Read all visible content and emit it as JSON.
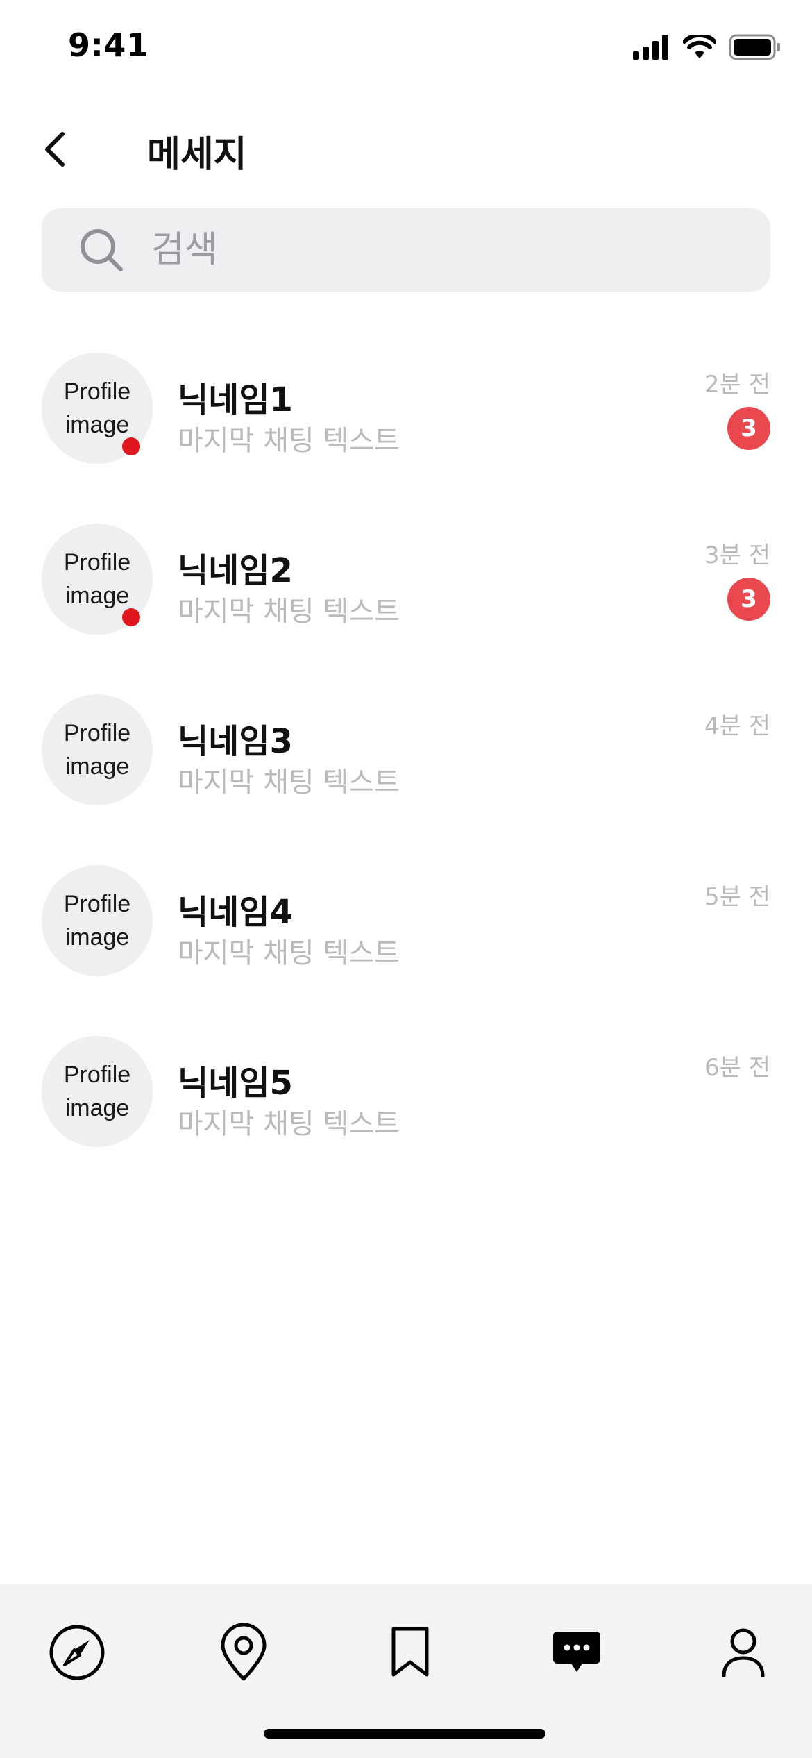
{
  "status_bar": {
    "time": "9:41"
  },
  "header": {
    "title": "메세지"
  },
  "search": {
    "placeholder": "검색"
  },
  "chats": [
    {
      "avatar_label": "Profile image",
      "nickname": "닉네임1",
      "last_message": "마지막 채팅 텍스트",
      "time_ago": "2분 전",
      "unread": "3",
      "online": true
    },
    {
      "avatar_label": "Profile image",
      "nickname": "닉네임2",
      "last_message": "마지막 채팅 텍스트",
      "time_ago": "3분 전",
      "unread": "3",
      "online": true
    },
    {
      "avatar_label": "Profile image",
      "nickname": "닉네임3",
      "last_message": "마지막 채팅 텍스트",
      "time_ago": "4분 전",
      "unread": "",
      "online": false
    },
    {
      "avatar_label": "Profile image",
      "nickname": "닉네임4",
      "last_message": "마지막 채팅 텍스트",
      "time_ago": "5분 전",
      "unread": "",
      "online": false
    },
    {
      "avatar_label": "Profile image",
      "nickname": "닉네임5",
      "last_message": "마지막 채팅 텍스트",
      "time_ago": "6분 전",
      "unread": "",
      "online": false
    }
  ],
  "bottom_nav": {
    "items": [
      {
        "icon": "compass-icon",
        "active": false
      },
      {
        "icon": "location-pin-icon",
        "active": false
      },
      {
        "icon": "bookmark-icon",
        "active": false
      },
      {
        "icon": "chat-bubble-icon",
        "active": true
      },
      {
        "icon": "profile-icon",
        "active": false
      }
    ]
  },
  "colors": {
    "accent_badge": "#e9484f",
    "online_dot": "#e0161e",
    "muted_text": "#b9babd",
    "surface": "#eeeff1"
  }
}
